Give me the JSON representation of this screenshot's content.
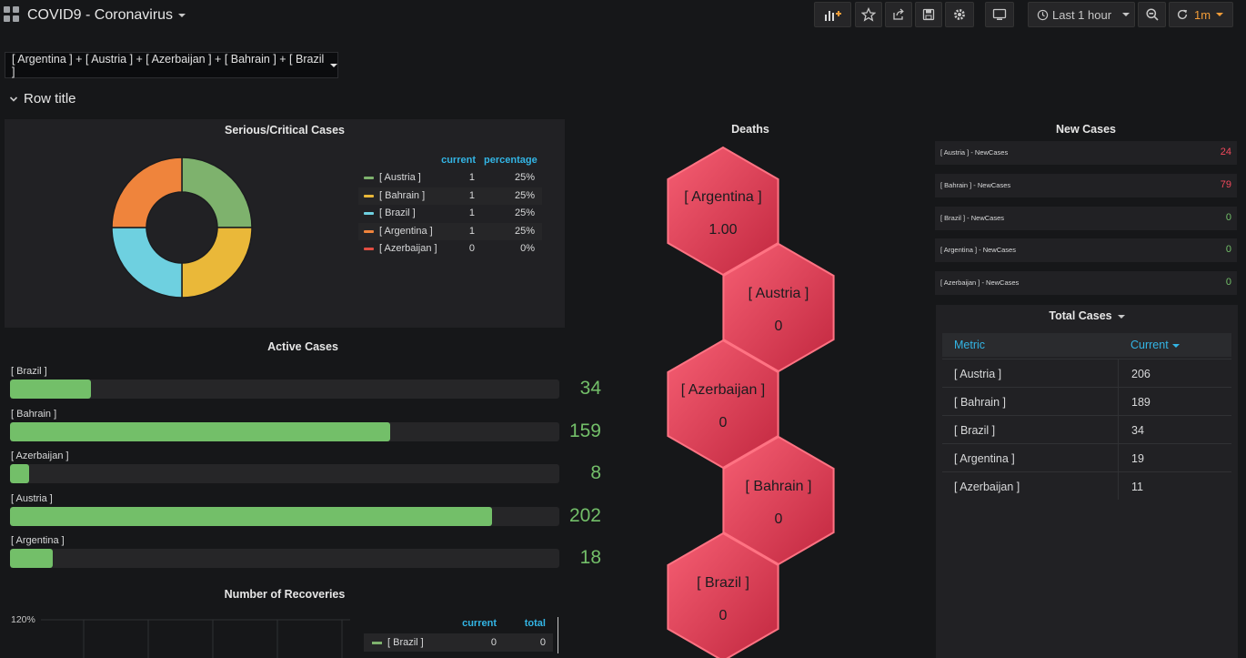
{
  "header": {
    "title": "COVID9 - Coronavirus",
    "time_range": "Last 1 hour",
    "refresh": "1m",
    "icons": [
      "add-panel-icon",
      "star-icon",
      "share-icon",
      "save-icon",
      "gear-icon",
      "tv-icon",
      "clock-icon",
      "zoom-out-icon",
      "refresh-icon"
    ]
  },
  "variable": {
    "value": "[ Argentina ] + [ Austria ] + [ Azerbaijan ] + [ Bahrain ] + [ Brazil ]"
  },
  "row": {
    "title": "Row title"
  },
  "critical": {
    "title": "Serious/Critical Cases",
    "col_current": "current",
    "col_percentage": "percentage",
    "items": [
      {
        "name": "[ Austria ]",
        "current": "1",
        "percentage": "25%",
        "color": "#7eb26d",
        "share": 0.25
      },
      {
        "name": "[ Bahrain ]",
        "current": "1",
        "percentage": "25%",
        "color": "#eab839",
        "share": 0.25
      },
      {
        "name": "[ Brazil ]",
        "current": "1",
        "percentage": "25%",
        "color": "#6ed0e0",
        "share": 0.25
      },
      {
        "name": "[ Argentina ]",
        "current": "1",
        "percentage": "25%",
        "color": "#ef843c",
        "share": 0.25
      },
      {
        "name": "[ Azerbaijan ]",
        "current": "0",
        "percentage": "0%",
        "color": "#e24d42",
        "share": 0
      }
    ]
  },
  "active": {
    "title": "Active Cases",
    "max": 230,
    "items": [
      {
        "name": "[ Brazil ]",
        "value": "34",
        "num": 34
      },
      {
        "name": "[ Bahrain ]",
        "value": "159",
        "num": 159
      },
      {
        "name": "[ Azerbaijan ]",
        "value": "8",
        "num": 8
      },
      {
        "name": "[ Austria ]",
        "value": "202",
        "num": 202
      },
      {
        "name": "[ Argentina ]",
        "value": "18",
        "num": 18
      }
    ]
  },
  "recoveries": {
    "title": "Number of Recoveries",
    "y_tick": "120%",
    "col_current": "current",
    "col_total": "total",
    "items": [
      {
        "name": "[ Brazil ]",
        "current": "0",
        "total": "0",
        "color": "#7eb26d"
      }
    ]
  },
  "deaths": {
    "title": "Deaths",
    "items": [
      {
        "name": "[ Argentina ]",
        "value": "1.00"
      },
      {
        "name": "[ Austria ]",
        "value": "0"
      },
      {
        "name": "[ Azerbaijan ]",
        "value": "0"
      },
      {
        "name": "[ Bahrain ]",
        "value": "0"
      },
      {
        "name": "[ Brazil ]",
        "value": "0"
      }
    ]
  },
  "new_cases": {
    "title": "New Cases",
    "items": [
      {
        "name": "[ Austria ] - NewCases",
        "value": "24",
        "color": "#f2495c"
      },
      {
        "name": "[ Bahrain ] - NewCases",
        "value": "79",
        "color": "#f2495c"
      },
      {
        "name": "[ Brazil ] - NewCases",
        "value": "0",
        "color": "#73bf69"
      },
      {
        "name": "[ Argentina ] - NewCases",
        "value": "0",
        "color": "#73bf69"
      },
      {
        "name": "[ Azerbaijan ] - NewCases",
        "value": "0",
        "color": "#73bf69"
      }
    ]
  },
  "total_cases": {
    "title": "Total Cases",
    "col_metric": "Metric",
    "col_current": "Current",
    "rows": [
      {
        "metric": "[ Austria ]",
        "current": "206"
      },
      {
        "metric": "[ Bahrain ]",
        "current": "189"
      },
      {
        "metric": "[ Brazil ]",
        "current": "34"
      },
      {
        "metric": "[ Argentina ]",
        "current": "19"
      },
      {
        "metric": "[ Azerbaijan ]",
        "current": "11"
      }
    ]
  }
}
